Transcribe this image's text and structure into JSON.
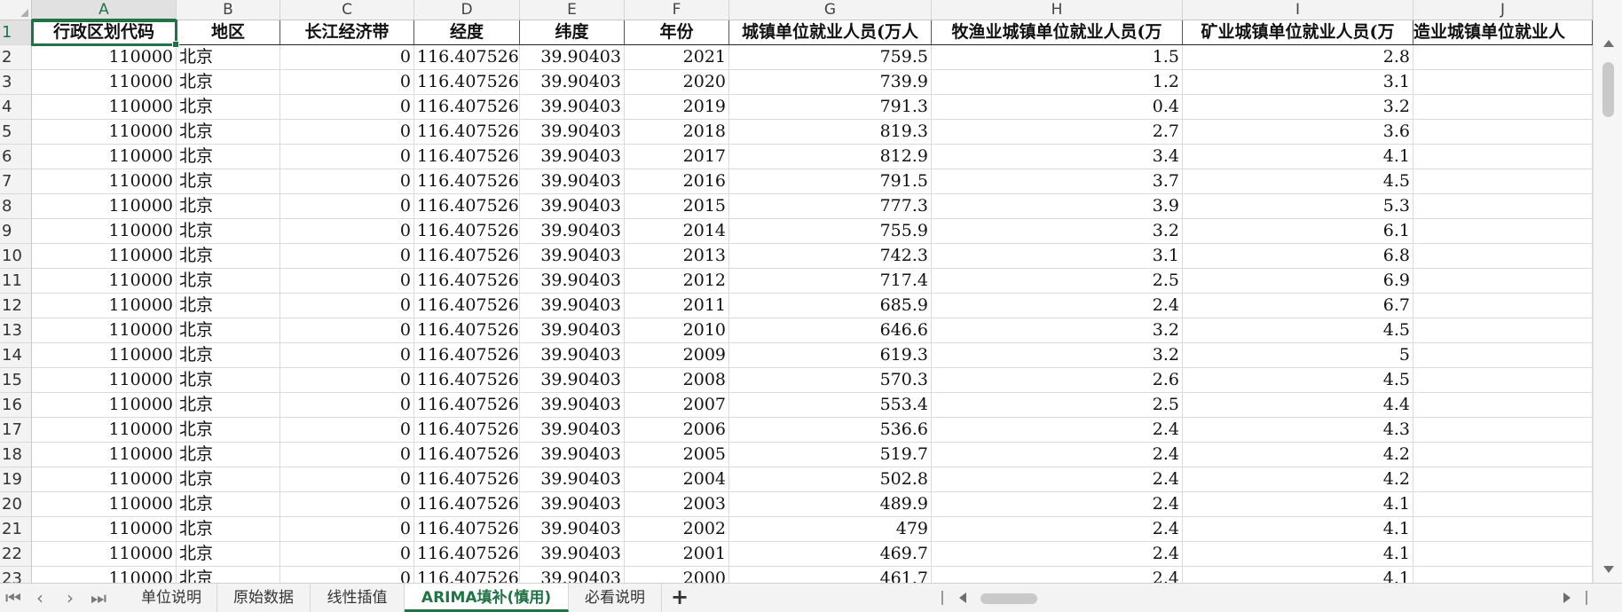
{
  "columns": [
    "A",
    "B",
    "C",
    "D",
    "E",
    "F",
    "G",
    "H",
    "I",
    "J"
  ],
  "rows": [
    "1",
    "2",
    "3",
    "4",
    "5",
    "6",
    "7",
    "8",
    "9",
    "10",
    "11",
    "12",
    "13",
    "14",
    "15",
    "16",
    "17",
    "18",
    "19",
    "20",
    "21",
    "22",
    "23"
  ],
  "headers": [
    "行政区划代码",
    "地区",
    "长江经济带",
    "经度",
    "纬度",
    "年份",
    "城镇单位就业人员(万人",
    "牧渔业城镇单位就业人员(万",
    "矿业城镇单位就业人员(万",
    "造业城镇单位就业人"
  ],
  "data": [
    [
      "110000",
      "北京",
      "0",
      "116.407526",
      "39.90403",
      "2021",
      "759.5",
      "1.5",
      "2.8"
    ],
    [
      "110000",
      "北京",
      "0",
      "116.407526",
      "39.90403",
      "2020",
      "739.9",
      "1.2",
      "3.1"
    ],
    [
      "110000",
      "北京",
      "0",
      "116.407526",
      "39.90403",
      "2019",
      "791.3",
      "0.4",
      "3.2"
    ],
    [
      "110000",
      "北京",
      "0",
      "116.407526",
      "39.90403",
      "2018",
      "819.3",
      "2.7",
      "3.6"
    ],
    [
      "110000",
      "北京",
      "0",
      "116.407526",
      "39.90403",
      "2017",
      "812.9",
      "3.4",
      "4.1"
    ],
    [
      "110000",
      "北京",
      "0",
      "116.407526",
      "39.90403",
      "2016",
      "791.5",
      "3.7",
      "4.5"
    ],
    [
      "110000",
      "北京",
      "0",
      "116.407526",
      "39.90403",
      "2015",
      "777.3",
      "3.9",
      "5.3"
    ],
    [
      "110000",
      "北京",
      "0",
      "116.407526",
      "39.90403",
      "2014",
      "755.9",
      "3.2",
      "6.1"
    ],
    [
      "110000",
      "北京",
      "0",
      "116.407526",
      "39.90403",
      "2013",
      "742.3",
      "3.1",
      "6.8"
    ],
    [
      "110000",
      "北京",
      "0",
      "116.407526",
      "39.90403",
      "2012",
      "717.4",
      "2.5",
      "6.9"
    ],
    [
      "110000",
      "北京",
      "0",
      "116.407526",
      "39.90403",
      "2011",
      "685.9",
      "2.4",
      "6.7"
    ],
    [
      "110000",
      "北京",
      "0",
      "116.407526",
      "39.90403",
      "2010",
      "646.6",
      "3.2",
      "4.5"
    ],
    [
      "110000",
      "北京",
      "0",
      "116.407526",
      "39.90403",
      "2009",
      "619.3",
      "3.2",
      "5"
    ],
    [
      "110000",
      "北京",
      "0",
      "116.407526",
      "39.90403",
      "2008",
      "570.3",
      "2.6",
      "4.5"
    ],
    [
      "110000",
      "北京",
      "0",
      "116.407526",
      "39.90403",
      "2007",
      "553.4",
      "2.5",
      "4.4"
    ],
    [
      "110000",
      "北京",
      "0",
      "116.407526",
      "39.90403",
      "2006",
      "536.6",
      "2.4",
      "4.3"
    ],
    [
      "110000",
      "北京",
      "0",
      "116.407526",
      "39.90403",
      "2005",
      "519.7",
      "2.4",
      "4.2"
    ],
    [
      "110000",
      "北京",
      "0",
      "116.407526",
      "39.90403",
      "2004",
      "502.8",
      "2.4",
      "4.2"
    ],
    [
      "110000",
      "北京",
      "0",
      "116.407526",
      "39.90403",
      "2003",
      "489.9",
      "2.4",
      "4.1"
    ],
    [
      "110000",
      "北京",
      "0",
      "116.407526",
      "39.90403",
      "2002",
      "479",
      "2.4",
      "4.1"
    ],
    [
      "110000",
      "北京",
      "0",
      "116.407526",
      "39.90403",
      "2001",
      "469.7",
      "2.4",
      "4.1"
    ],
    [
      "110000",
      "北京",
      "0",
      "116.407526",
      "39.90403",
      "2000",
      "461.7",
      "2.4",
      "4.1"
    ]
  ],
  "sheet_tabs": [
    "单位说明",
    "原始数据",
    "线性插值",
    "ARIMA填补(慎用)",
    "必看说明"
  ],
  "active_tab": "ARIMA填补(慎用)",
  "add_tab_label": "+",
  "colors": {
    "accent": "#217346",
    "header_bg": "#f3f3f3"
  }
}
